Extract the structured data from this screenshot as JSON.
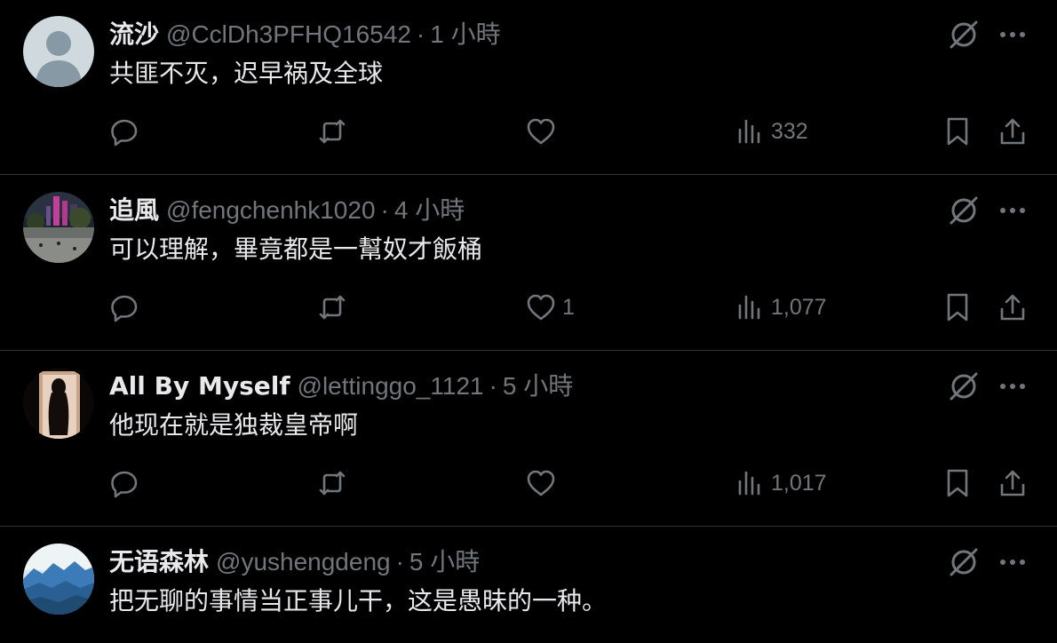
{
  "posts": [
    {
      "name": "流沙",
      "handle": "@CclDh3PFHQ16542",
      "separator": "·",
      "time": "1 小時",
      "text": "共匪不灭，迟早祸及全球",
      "replies": "",
      "retweets": "",
      "likes": "",
      "views": "332",
      "avatar_icon": "default-avatar-icon"
    },
    {
      "name": "追風",
      "handle": "@fengchenhk1020",
      "separator": "·",
      "time": "4 小時",
      "text": "可以理解，畢竟都是一幫奴才飯桶",
      "replies": "",
      "retweets": "",
      "likes": "1",
      "views": "1,077",
      "avatar_icon": "city-night-avatar"
    },
    {
      "name": "All By Myself",
      "handle": "@lettinggo_1121",
      "separator": "·",
      "time": "5 小時",
      "text": "他现在就是独裁皇帝啊",
      "replies": "",
      "retweets": "",
      "likes": "",
      "views": "1,017",
      "avatar_icon": "silhouette-avatar"
    },
    {
      "name": "无语森林",
      "handle": "@yushengdeng",
      "separator": "·",
      "time": "5 小時",
      "text": "把无聊的事情当正事儿干，这是愚昧的一种。",
      "avatar_icon": "mountain-avatar"
    }
  ],
  "colors": {
    "background": "#000000",
    "text": "#e7e9ea",
    "muted": "#71767b",
    "divider": "#2f3336"
  }
}
